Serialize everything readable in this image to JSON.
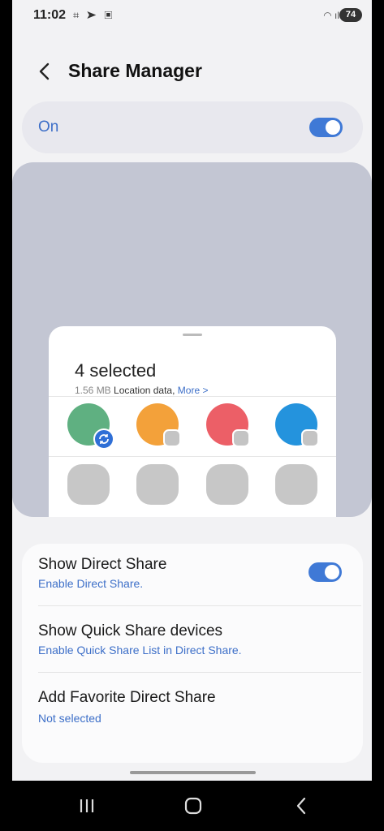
{
  "status": {
    "time": "11:02",
    "left_icons": "⌗ ➤ ▣",
    "right_icons": "◠ ıl",
    "battery": "74"
  },
  "header": {
    "title": "Share Manager",
    "back_icon": "chevron-left-icon"
  },
  "master_toggle": {
    "label": "On",
    "state": true
  },
  "preview": {
    "selected_title": "4 selected",
    "size": "1.56 MB",
    "location_text": "Location data,",
    "more_link": "More >",
    "apps": [
      {
        "color": "#5fb081"
      },
      {
        "color": "#f3a13a"
      },
      {
        "color": "#ec5f67"
      },
      {
        "color": "#2493dd"
      }
    ]
  },
  "settings": [
    {
      "title": "Show Direct Share",
      "subtitle": "Enable Direct Share.",
      "toggle": true
    },
    {
      "title": "Show Quick Share devices",
      "subtitle": "Enable Quick Share List in Direct Share.",
      "toggle": false
    },
    {
      "title": "Add Favorite Direct Share",
      "subtitle": "Not selected",
      "toggle": false
    }
  ],
  "nav": {
    "recents_icon": "recents-icon",
    "home_icon": "home-icon",
    "back_icon": "back-icon"
  },
  "colors": {
    "accent": "#3f79d6",
    "link": "#3d6fc8",
    "preview_bg": "#c3c6d3"
  }
}
